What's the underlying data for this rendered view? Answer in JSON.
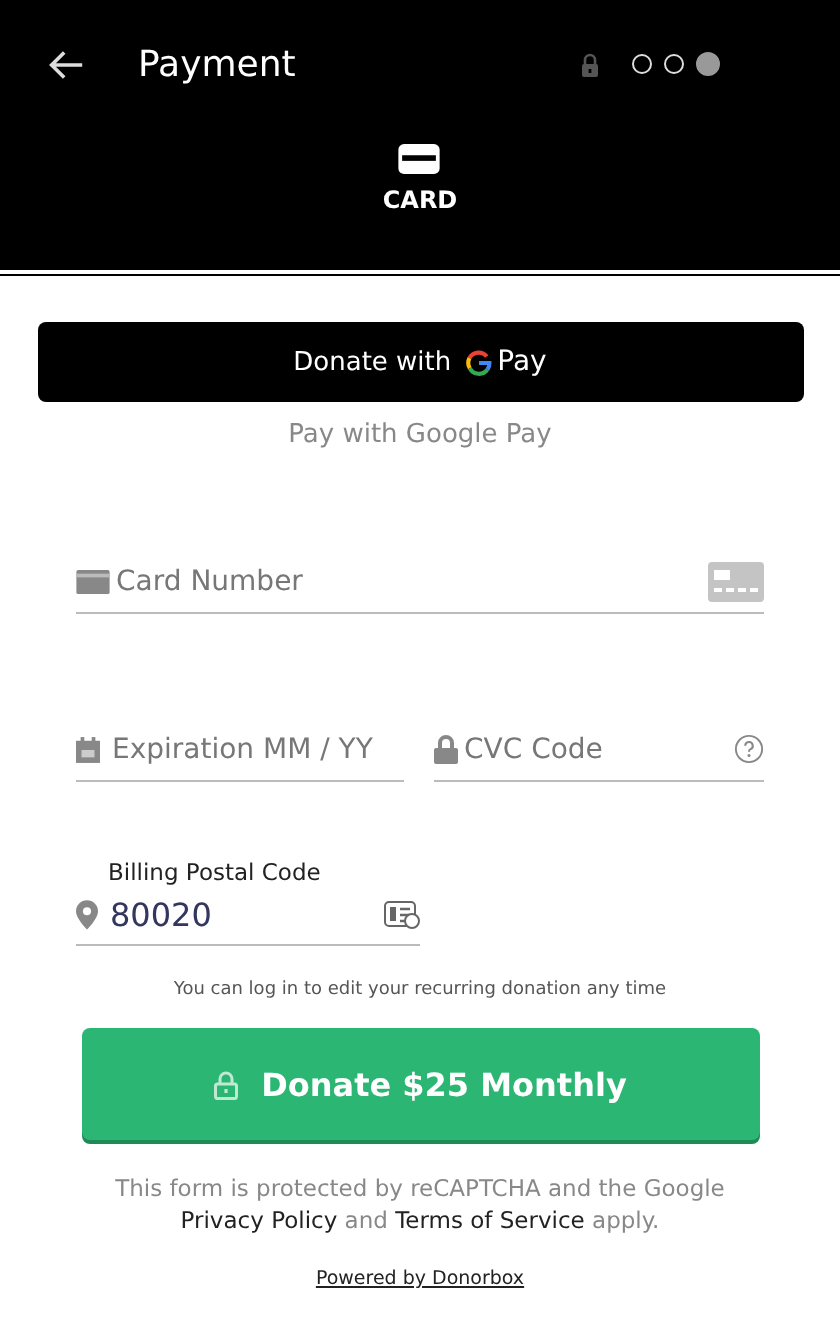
{
  "header": {
    "title": "Payment",
    "steps": [
      {
        "selected": false
      },
      {
        "selected": false
      },
      {
        "selected": true
      }
    ]
  },
  "tabs": [
    {
      "label": "CARD",
      "selected": true
    }
  ],
  "gpay": {
    "label": "Donate with",
    "brand": "Pay",
    "caption": "Pay with Google Pay"
  },
  "fields": {
    "card_number": {
      "placeholder": "Card Number"
    },
    "expiration": {
      "placeholder": "Expiration MM / YY"
    },
    "cvc": {
      "placeholder": "CVC Code"
    },
    "postal": {
      "label": "Billing Postal Code",
      "value": "80020"
    }
  },
  "note": "You can log in to edit your recurring donation any time",
  "donate_button": "Donate $25 Monthly",
  "recaptcha": {
    "before": "This form is protected by reCAPTCHA and the Google",
    "privacy": "Privacy Policy",
    "middle": "and",
    "terms": "Terms of Service",
    "after": "apply."
  },
  "powered_by": "Powered by Donorbox"
}
